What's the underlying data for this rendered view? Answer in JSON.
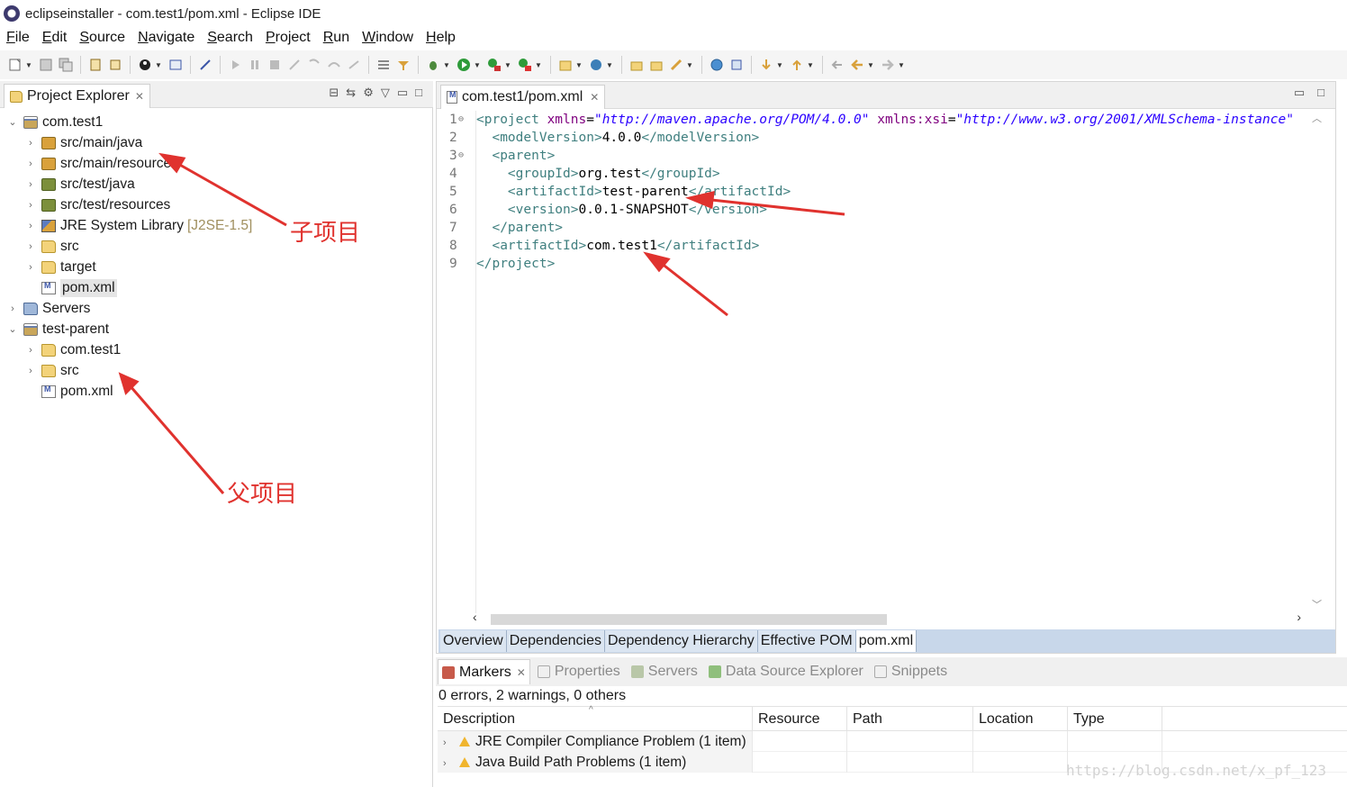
{
  "window": {
    "title": "eclipseinstaller - com.test1/pom.xml - Eclipse IDE"
  },
  "menu": [
    "File",
    "Edit",
    "Source",
    "Navigate",
    "Search",
    "Project",
    "Run",
    "Window",
    "Help"
  ],
  "explorer": {
    "tab_label": "Project Explorer",
    "items": [
      {
        "label": "com.test1",
        "expanded": true,
        "icon": "maven-project-icon"
      },
      {
        "label": "src/main/java",
        "icon": "source-folder-icon"
      },
      {
        "label": "src/main/resources",
        "icon": "source-folder-icon"
      },
      {
        "label": "src/test/java",
        "icon": "test-source-folder-icon"
      },
      {
        "label": "src/test/resources",
        "icon": "test-source-folder-icon"
      },
      {
        "label": "JRE System Library",
        "decoration": "[J2SE-1.5]",
        "icon": "library-icon"
      },
      {
        "label": "src",
        "icon": "folder-icon"
      },
      {
        "label": "target",
        "icon": "folder-icon"
      },
      {
        "label": "pom.xml",
        "icon": "xml-file-icon",
        "selected": true
      },
      {
        "label": "Servers",
        "icon": "servers-folder-icon"
      },
      {
        "label": "test-parent",
        "expanded": true,
        "icon": "maven-project-icon"
      },
      {
        "label": "com.test1",
        "icon": "folder-icon"
      },
      {
        "label": "src",
        "icon": "folder-icon"
      },
      {
        "label": "pom.xml",
        "icon": "xml-file-icon"
      }
    ]
  },
  "annotations": {
    "child": "子项目",
    "parent": "父项目",
    "color": "#e0322e"
  },
  "editor": {
    "tab_label": "com.test1/pom.xml",
    "line_numbers": [
      "1",
      "2",
      "3",
      "4",
      "5",
      "6",
      "7",
      "8",
      "9"
    ],
    "fold_markers": [
      "⊖",
      "",
      "⊖",
      "",
      "",
      "",
      "",
      "",
      ""
    ],
    "lines": [
      {
        "indent": "",
        "parts": [
          [
            "tag",
            "<project "
          ],
          [
            "attr",
            "xmlns"
          ],
          [
            "plain",
            "="
          ],
          [
            "val",
            "\"http://maven.apache.org/POM/4.0.0\""
          ],
          [
            "plain",
            " "
          ],
          [
            "attr",
            "xmlns:xsi"
          ],
          [
            "plain",
            "="
          ],
          [
            "val",
            "\"http://www.w3.org/2001/XMLSchema-instance\""
          ]
        ]
      },
      {
        "indent": "  ",
        "parts": [
          [
            "tag",
            "<modelVersion>"
          ],
          [
            "plain",
            "4.0.0"
          ],
          [
            "tag",
            "</modelVersion>"
          ]
        ]
      },
      {
        "indent": "  ",
        "parts": [
          [
            "tag",
            "<parent>"
          ]
        ]
      },
      {
        "indent": "    ",
        "parts": [
          [
            "tag",
            "<groupId>"
          ],
          [
            "plain",
            "org.test"
          ],
          [
            "tag",
            "</groupId>"
          ]
        ]
      },
      {
        "indent": "    ",
        "parts": [
          [
            "tag",
            "<artifactId>"
          ],
          [
            "plain",
            "test-parent"
          ],
          [
            "tag",
            "</artifactId>"
          ]
        ]
      },
      {
        "indent": "    ",
        "parts": [
          [
            "tag",
            "<version>"
          ],
          [
            "plain",
            "0.0.1-SNAPSHOT"
          ],
          [
            "tag",
            "</version>"
          ]
        ]
      },
      {
        "indent": "  ",
        "parts": [
          [
            "tag",
            "</parent>"
          ]
        ]
      },
      {
        "indent": "  ",
        "parts": [
          [
            "tag",
            "<artifactId>"
          ],
          [
            "plain",
            "com.test1"
          ],
          [
            "tag",
            "</artifactId>"
          ]
        ]
      },
      {
        "indent": "",
        "parts": [
          [
            "tag",
            "</project>"
          ]
        ]
      }
    ],
    "page_tabs": [
      "Overview",
      "Dependencies",
      "Dependency Hierarchy",
      "Effective POM",
      "pom.xml"
    ],
    "active_page_tab": "pom.xml"
  },
  "markers": {
    "tabs": [
      {
        "label": "Markers",
        "active": true,
        "icon": "markers-icon"
      },
      {
        "label": "Properties",
        "icon": "properties-icon"
      },
      {
        "label": "Servers",
        "icon": "servers-icon"
      },
      {
        "label": "Data Source Explorer",
        "icon": "data-source-icon"
      },
      {
        "label": "Snippets",
        "icon": "snippets-icon"
      }
    ],
    "summary": "0 errors, 2 warnings, 0 others",
    "columns": [
      "Description",
      "Resource",
      "Path",
      "Location",
      "Type"
    ],
    "rows": [
      {
        "description": "JRE Compiler Compliance Problem (1 item)",
        "resource": "",
        "path": "",
        "location": "",
        "type": ""
      },
      {
        "description": "Java Build Path Problems (1 item)",
        "resource": "",
        "path": "",
        "location": "",
        "type": ""
      }
    ]
  },
  "watermark": "https://blog.csdn.net/x_pf_123"
}
